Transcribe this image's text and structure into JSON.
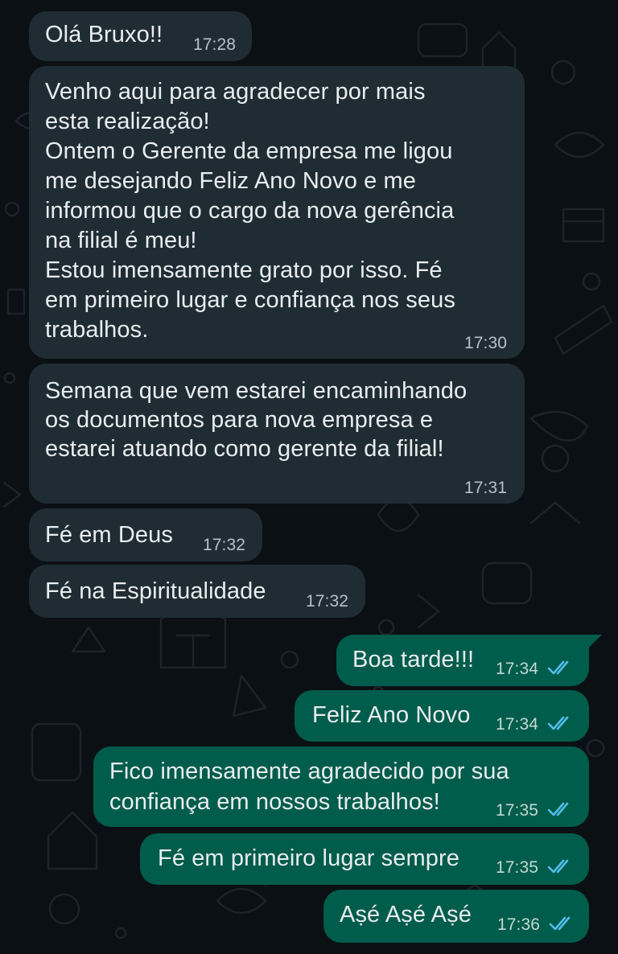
{
  "messages": [
    {
      "direction": "incoming",
      "text": "Olá Bruxo!!",
      "time": "17:28"
    },
    {
      "direction": "incoming",
      "text": "Venho aqui para agradecer por mais\nesta realização!\nOntem o Gerente da empresa me ligou\nme desejando Feliz Ano Novo e me\ninformou que o cargo da nova gerência\nna filial é meu!\nEstou imensamente grato por isso. Fé\nem primeiro lugar e confiança nos seus\ntrabalhos.",
      "time": "17:30"
    },
    {
      "direction": "incoming",
      "text": "Semana que vem estarei encaminhando\nos documentos para nova empresa e\nestarei atuando como gerente da filial!",
      "time": "17:31"
    },
    {
      "direction": "incoming",
      "text": "Fé em Deus",
      "time": "17:32"
    },
    {
      "direction": "incoming",
      "text": "Fé na Espiritualidade",
      "time": "17:32"
    },
    {
      "direction": "outgoing",
      "text": "Boa tarde!!!",
      "time": "17:34",
      "status": "read"
    },
    {
      "direction": "outgoing",
      "text": "Feliz Ano Novo",
      "time": "17:34",
      "status": "read"
    },
    {
      "direction": "outgoing",
      "text": "Fico imensamente agradecido por sua\nconfiança em nossos trabalhos!",
      "time": "17:35",
      "status": "read"
    },
    {
      "direction": "outgoing",
      "text": "Fé em primeiro lugar sempre",
      "time": "17:35",
      "status": "read"
    },
    {
      "direction": "outgoing",
      "text": "Aṣé Aṣé Aṣé",
      "time": "17:36",
      "status": "read"
    }
  ],
  "colors": {
    "background": "#0b1014",
    "incoming_bubble": "#1f2c34",
    "outgoing_bubble": "#005c4b",
    "read_ticks": "#53bdeb"
  }
}
